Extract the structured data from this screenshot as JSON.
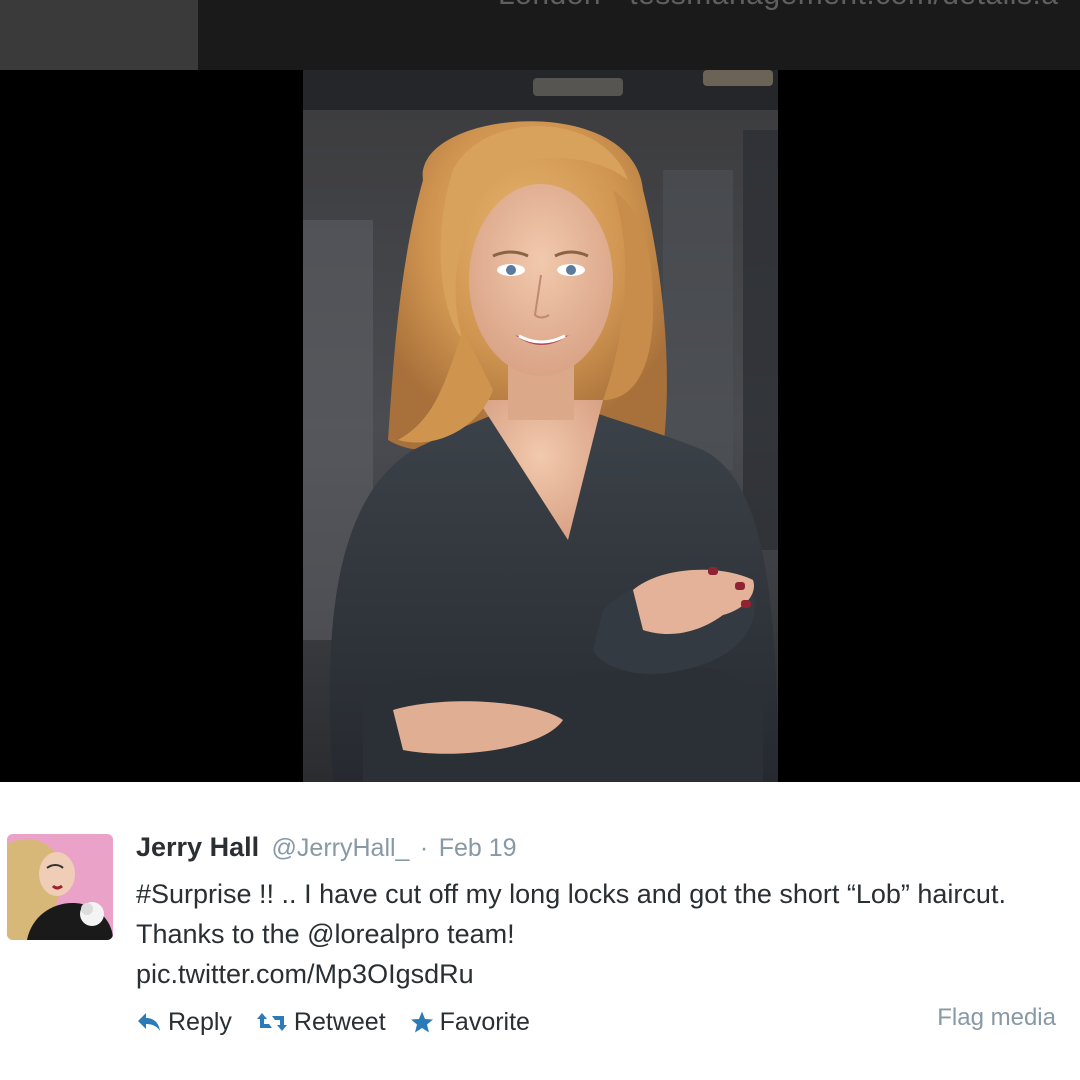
{
  "header": {
    "partial_text": "London · tessmanagement.com/details.a"
  },
  "media": {
    "alt": "Photo of woman with shoulder-length blonde hair in a dark wrap top, arms crossed"
  },
  "tweet": {
    "display_name": "Jerry Hall",
    "handle": "@JerryHall_",
    "separator": "·",
    "date": "Feb 19",
    "text": "#Surprise !! .. I have cut off my long locks and got the short “Lob” haircut. Thanks to the @lorealpro team!",
    "link": "pic.twitter.com/Mp3OIgsdRu"
  },
  "actions": {
    "reply_label": "Reply",
    "retweet_label": "Retweet",
    "favorite_label": "Favorite",
    "flag_label": "Flag media"
  },
  "icons": {
    "reply": "reply-icon",
    "retweet": "retweet-icon",
    "favorite": "star-icon"
  },
  "colors": {
    "action_icon": "#2b7bb9",
    "muted_text": "#8899a6",
    "body_text": "#292f33"
  }
}
